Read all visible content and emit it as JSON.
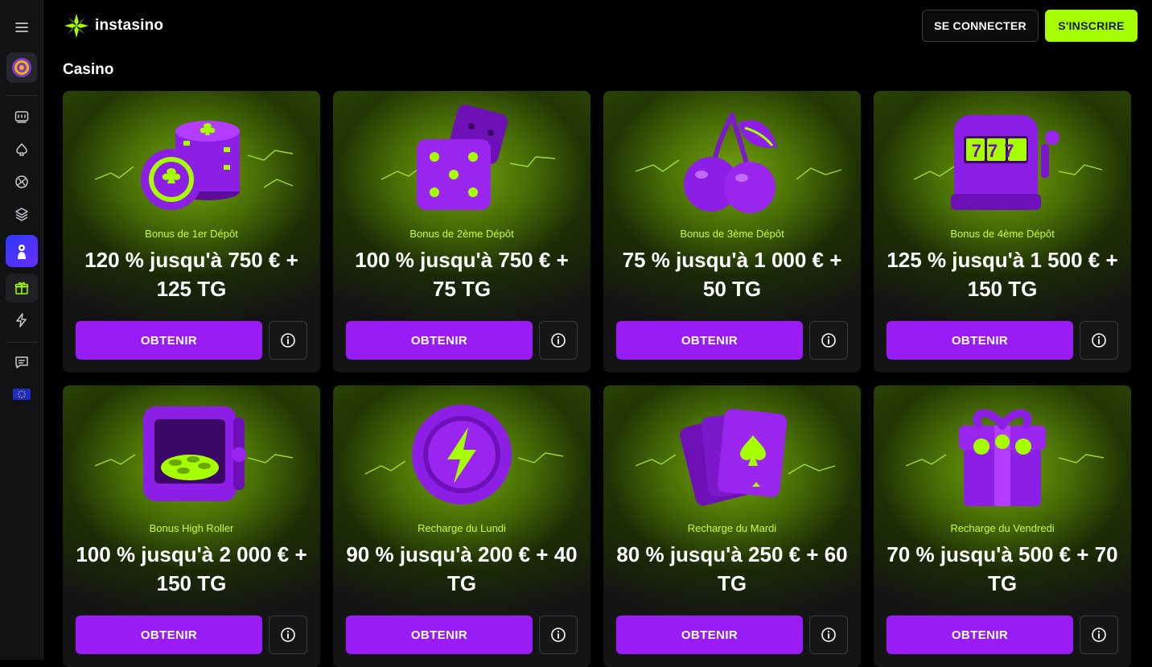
{
  "header": {
    "brand": "instasino",
    "login_label": "SE CONNECTER",
    "register_label": "S'INSCRIRE"
  },
  "sidebar": {
    "items": [
      {
        "icon": "menu-icon"
      },
      {
        "icon": "avatar-target-icon"
      },
      {
        "icon": "slots-icon"
      },
      {
        "icon": "spade-icon"
      },
      {
        "icon": "sports-ball-icon"
      },
      {
        "icon": "layers-icon"
      },
      {
        "icon": "promo-character-icon"
      },
      {
        "icon": "gift-icon",
        "active": true
      },
      {
        "icon": "lightning-icon"
      },
      {
        "icon": "chat-icon"
      },
      {
        "icon": "eu-flag-icon"
      }
    ]
  },
  "section_title": "Casino",
  "colors": {
    "accent_green": "#a6ff00",
    "label_green": "#c6ff3a",
    "purple_button": "#9a1cf5"
  },
  "cards": [
    {
      "art": "chips-icon",
      "label": "Bonus de 1er Dépôt",
      "title": "120 % jusqu'à 750 € + 125 TG",
      "cta": "OBTENIR"
    },
    {
      "art": "dice-icon",
      "label": "Bonus de 2ème Dépôt",
      "title": "100 % jusqu'à 750 € + 75 TG",
      "cta": "OBTENIR"
    },
    {
      "art": "cherries-icon",
      "label": "Bonus de 3ème Dépôt",
      "title": "75 % jusqu'à 1 000 € + 50 TG",
      "cta": "OBTENIR"
    },
    {
      "art": "slot-machine-icon",
      "label": "Bonus de 4ème Dépôt",
      "title": "125 % jusqu'à 1 500 € + 150 TG",
      "cta": "OBTENIR",
      "reels": "777"
    },
    {
      "art": "safe-icon",
      "label": "Bonus High Roller",
      "title": "100 % jusqu'à 2 000 € + 150 TG",
      "cta": "OBTENIR"
    },
    {
      "art": "lightning-coin-icon",
      "label": "Recharge du Lundi",
      "title": "90 % jusqu'à 200 € + 40 TG",
      "cta": "OBTENIR"
    },
    {
      "art": "cards-icon",
      "label": "Recharge du Mardi",
      "title": "80 % jusqu'à 250 € + 60 TG",
      "cta": "OBTENIR"
    },
    {
      "art": "gift-box-icon",
      "label": "Recharge du Vendredi",
      "title": "70 % jusqu'à 500 € + 70 TG",
      "cta": "OBTENIR"
    }
  ]
}
